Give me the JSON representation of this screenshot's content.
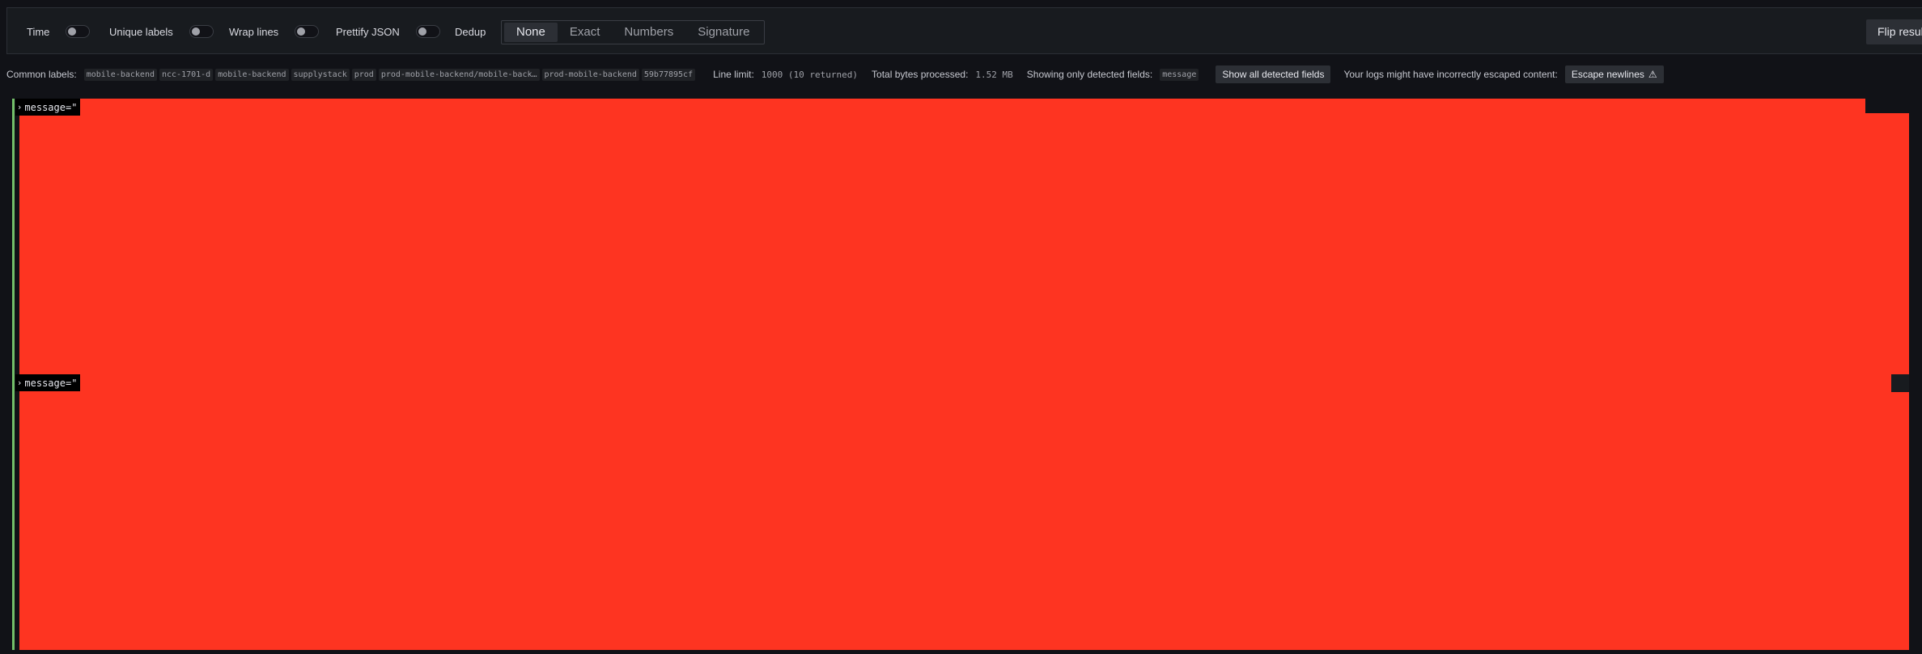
{
  "toolbar": {
    "options": [
      {
        "label": "Time",
        "on": false
      },
      {
        "label": "Unique labels",
        "on": false
      },
      {
        "label": "Wrap lines",
        "on": false
      },
      {
        "label": "Prettify JSON",
        "on": false
      },
      {
        "label": "Dedup",
        "on": false
      }
    ],
    "dedup_modes": [
      "None",
      "Exact",
      "Numbers",
      "Signature"
    ],
    "dedup_selected": "None",
    "flip_label": "Flip results"
  },
  "meta": {
    "common_labels_title": "Common labels:",
    "common_labels": [
      "mobile-backend",
      "ncc-1701-d",
      "mobile-backend",
      "supplystack",
      "prod",
      "prod-mobile-backend/mobile-back…",
      "prod-mobile-backend",
      "59b77895cf"
    ],
    "line_limit_title": "Line limit:",
    "line_limit_value": "1000 (10 returned)",
    "bytes_title": "Total bytes processed:",
    "bytes_value": "1.52 MB",
    "detected_title": "Showing only detected fields:",
    "detected_value": "message",
    "show_all_button": "Show all detected fields",
    "escape_warning": "Your logs might have incorrectly escaped content:",
    "escape_button": "Escape newlines",
    "escape_icon": "warning-triangle-icon"
  },
  "rows": [
    {
      "text": "message=\"",
      "level_color": "#73bf69"
    },
    {
      "text": "message=\"",
      "level_color": "#73bf69"
    }
  ],
  "colors": {
    "redaction": "#fe3421",
    "background": "#111217",
    "level_bar": "#73bf69"
  }
}
